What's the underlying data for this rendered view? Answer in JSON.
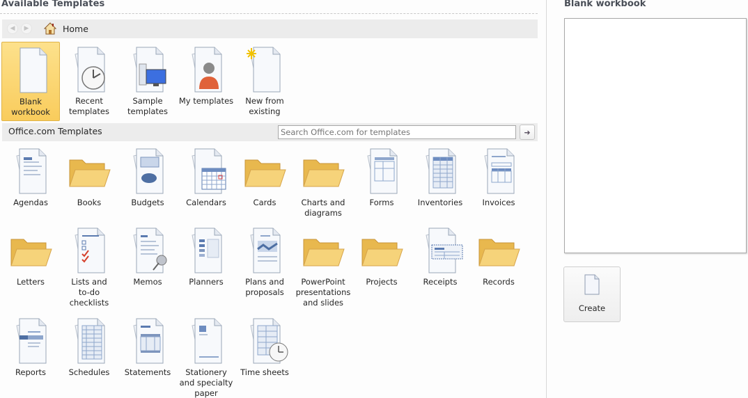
{
  "left": {
    "title": "Available Templates",
    "nav": {
      "back_icon": "back-arrow-icon",
      "forward_icon": "forward-arrow-icon",
      "home_icon": "home-icon",
      "home_label": "Home"
    },
    "top_items": [
      {
        "label_lines": [
          "Blank",
          "workbook"
        ],
        "icon": "blank-document-icon",
        "selected": true
      },
      {
        "label_lines": [
          "Recent",
          "templates"
        ],
        "icon": "recent-templates-clock-icon",
        "selected": false
      },
      {
        "label_lines": [
          "Sample",
          "templates"
        ],
        "icon": "sample-templates-monitor-icon",
        "selected": false
      },
      {
        "label_lines": [
          "My templates"
        ],
        "icon": "my-templates-person-icon",
        "selected": false
      },
      {
        "label_lines": [
          "New from",
          "existing"
        ],
        "icon": "new-from-existing-icon",
        "selected": false
      }
    ],
    "office": {
      "title": "Office.com Templates",
      "search_placeholder": "Search Office.com for templates",
      "search_button_icon": "arrow-right-icon"
    },
    "categories": [
      {
        "label_lines": [
          "Agendas"
        ],
        "icon": "doc"
      },
      {
        "label_lines": [
          "Books"
        ],
        "icon": "folder"
      },
      {
        "label_lines": [
          "Budgets"
        ],
        "icon": "doc"
      },
      {
        "label_lines": [
          "Calendars"
        ],
        "icon": "doc"
      },
      {
        "label_lines": [
          "Cards"
        ],
        "icon": "folder"
      },
      {
        "label_lines": [
          "Charts and",
          "diagrams"
        ],
        "icon": "folder"
      },
      {
        "label_lines": [
          "Forms"
        ],
        "icon": "doc"
      },
      {
        "label_lines": [
          "Inventories"
        ],
        "icon": "doc"
      },
      {
        "label_lines": [
          "Invoices"
        ],
        "icon": "doc"
      },
      {
        "label_lines": [
          "Letters"
        ],
        "icon": "folder"
      },
      {
        "label_lines": [
          "Lists and",
          "to-do",
          "checklists"
        ],
        "icon": "doc"
      },
      {
        "label_lines": [
          "Memos"
        ],
        "icon": "doc"
      },
      {
        "label_lines": [
          "Planners"
        ],
        "icon": "doc"
      },
      {
        "label_lines": [
          "Plans and",
          "proposals"
        ],
        "icon": "doc"
      },
      {
        "label_lines": [
          "PowerPoint",
          "presentations",
          "and slides"
        ],
        "icon": "folder"
      },
      {
        "label_lines": [
          "Projects"
        ],
        "icon": "folder"
      },
      {
        "label_lines": [
          "Receipts"
        ],
        "icon": "doc"
      },
      {
        "label_lines": [
          "Records"
        ],
        "icon": "folder"
      },
      {
        "label_lines": [
          "Reports"
        ],
        "icon": "doc"
      },
      {
        "label_lines": [
          "Schedules"
        ],
        "icon": "doc"
      },
      {
        "label_lines": [
          "Statements"
        ],
        "icon": "doc"
      },
      {
        "label_lines": [
          "Stationery",
          "and specialty",
          "paper"
        ],
        "icon": "doc"
      },
      {
        "label_lines": [
          "Time sheets"
        ],
        "icon": "doc"
      }
    ]
  },
  "right": {
    "title": "Blank workbook",
    "create_label": "Create",
    "create_icon": "blank-document-icon"
  },
  "colors": {
    "selected_tile": "#f9cc5c",
    "folder": "#f2c864",
    "doc_accent": "#5b7bb0"
  }
}
